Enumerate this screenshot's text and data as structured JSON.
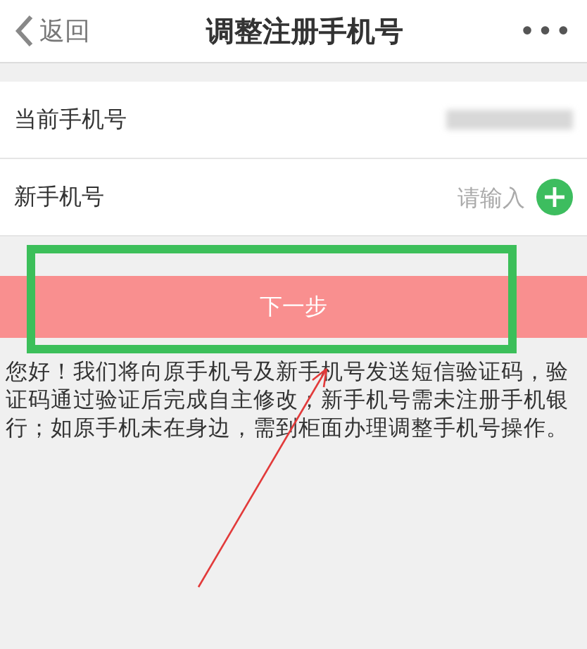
{
  "header": {
    "back": "返回",
    "title": "调整注册手机号",
    "more": "•••"
  },
  "rows": [
    {
      "kind": "masked",
      "label": "当前手机号"
    },
    {
      "kind": "input",
      "label": "新手机号",
      "placeholder": "请输入"
    }
  ],
  "button": "下一步",
  "notice": "您好！我们将向原手机号及新手机号发送短信验证码，验证码通过验证后完成自主修改；新手机号需未注册手机银行；如原手机未在身边，需到柜面办理调整手机号操作。",
  "annotations": [
    {
      "kind": "frame",
      "color": "#3cbf5a"
    },
    {
      "kind": "arrow",
      "color": "#e23a3a"
    }
  ]
}
